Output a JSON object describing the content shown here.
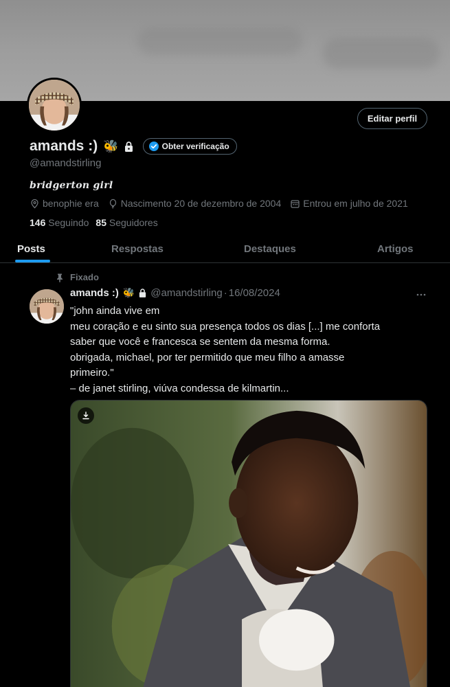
{
  "profile": {
    "name": "amands :)",
    "emoji": "🐝",
    "verify_label": "Obter verificação",
    "handle": "@amandstirling",
    "bio": "bridgerton girl",
    "location": "benophie era",
    "birth": "Nascimento 20 de dezembro de 2004",
    "joined": "Entrou em julho de 2021",
    "following_count": "146",
    "following_label": "Seguindo",
    "followers_count": "85",
    "followers_label": "Seguidores",
    "edit_label": "Editar perfil"
  },
  "tabs": [
    {
      "label": "Posts",
      "active": true
    },
    {
      "label": "Respostas",
      "active": false
    },
    {
      "label": "Destaques",
      "active": false
    },
    {
      "label": "Artigos",
      "active": false
    }
  ],
  "pinned": {
    "pin_label": "Fixado",
    "author": "amands :)",
    "emoji": "🐝",
    "handle": "@amandstirling",
    "separator": "·",
    "date": "16/08/2024",
    "lines": [
      "\"john ainda vive em",
      "meu coração e eu sinto sua presença todos os dias [...] me conforta",
      "saber que você e francesca se sentem da mesma forma.",
      "obrigada, michael, por ter permitido que meu filho a amasse",
      "primeiro.\"",
      "– de janet stirling, viúva condessa de kilmartin..."
    ]
  },
  "colors": {
    "accent": "#1d9bf0",
    "text": "#e7e9ea",
    "muted": "#71767b",
    "border": "#2f3336"
  },
  "icons": [
    "lock-icon",
    "verified-badge-icon",
    "location-icon",
    "birthday-icon",
    "calendar-icon",
    "pin-icon",
    "more-icon",
    "download-icon"
  ]
}
